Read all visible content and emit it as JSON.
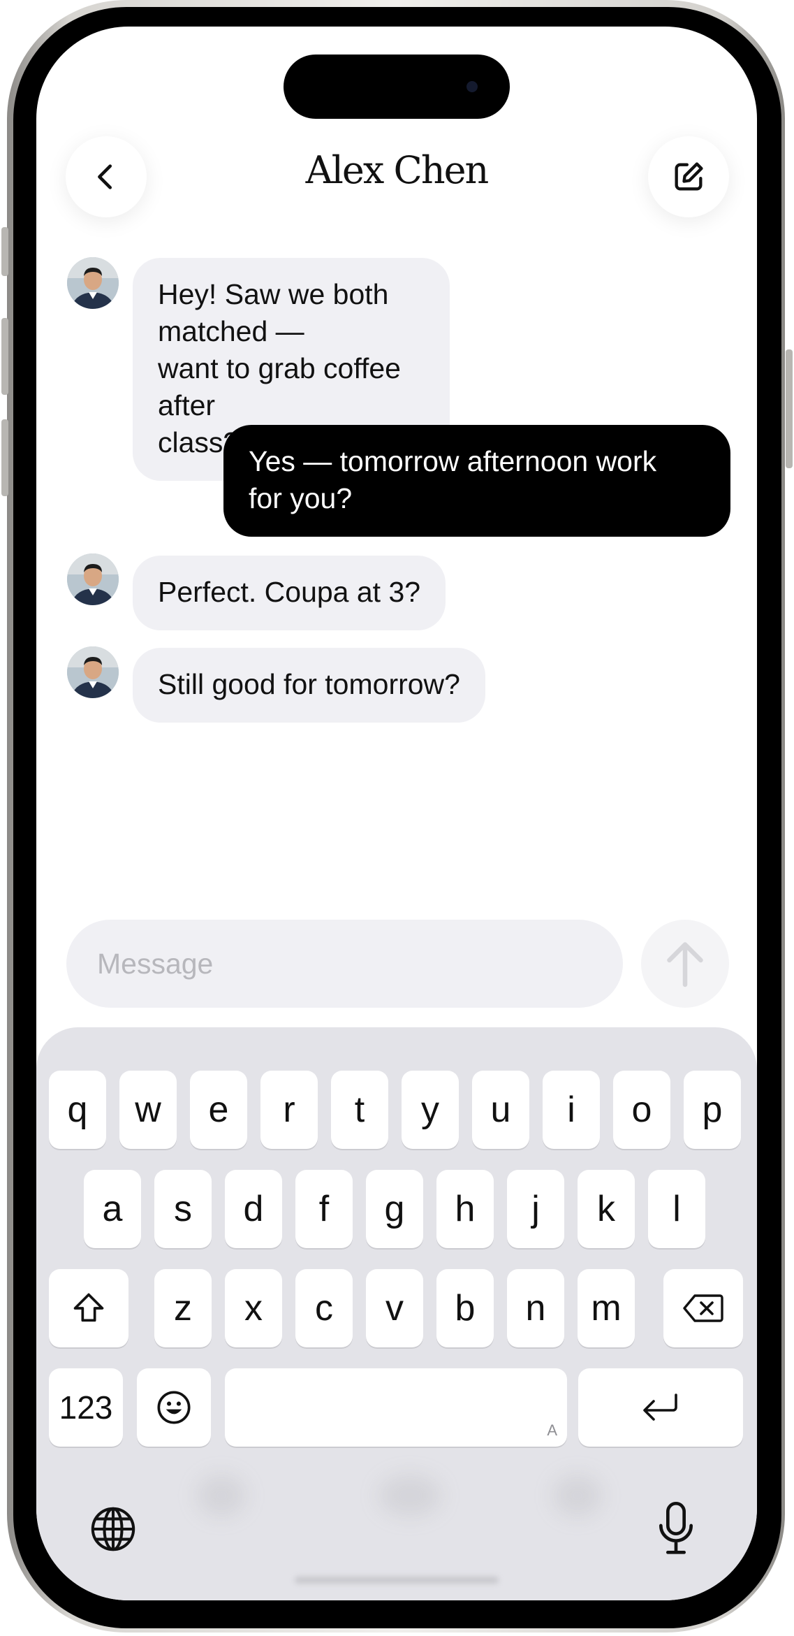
{
  "header": {
    "title": "Alex Chen",
    "back_icon": "chevron-left-icon",
    "compose_icon": "compose-icon"
  },
  "messages": [
    {
      "direction": "incoming",
      "lines": [
        "Hey! Saw we both matched —",
        "want to grab coffee after",
        "class?"
      ]
    },
    {
      "direction": "outgoing",
      "lines": [
        "Yes — tomorrow afternoon work",
        "for you?"
      ]
    },
    {
      "direction": "incoming",
      "lines": [
        "Perfect. Coupa at 3?"
      ]
    },
    {
      "direction": "incoming",
      "lines": [
        "Still good for tomorrow?"
      ]
    }
  ],
  "composer": {
    "placeholder": "Message",
    "send_icon": "arrow-up-icon"
  },
  "keyboard": {
    "row1": [
      "q",
      "w",
      "e",
      "r",
      "t",
      "y",
      "u",
      "i",
      "o",
      "p"
    ],
    "row2": [
      "a",
      "s",
      "d",
      "f",
      "g",
      "h",
      "j",
      "k",
      "l"
    ],
    "row3": [
      "z",
      "x",
      "c",
      "v",
      "b",
      "n",
      "m"
    ],
    "numbers_label": "123",
    "space_hint": "A",
    "shift_icon": "shift-icon",
    "delete_icon": "delete-icon",
    "emoji_icon": "emoji-icon",
    "return_icon": "return-icon",
    "globe_icon": "globe-icon",
    "mic_icon": "microphone-icon"
  },
  "colors": {
    "incoming_bubble": "#f0f0f4",
    "outgoing_bubble": "#000000",
    "keyboard_bg": "#e3e3e8"
  }
}
